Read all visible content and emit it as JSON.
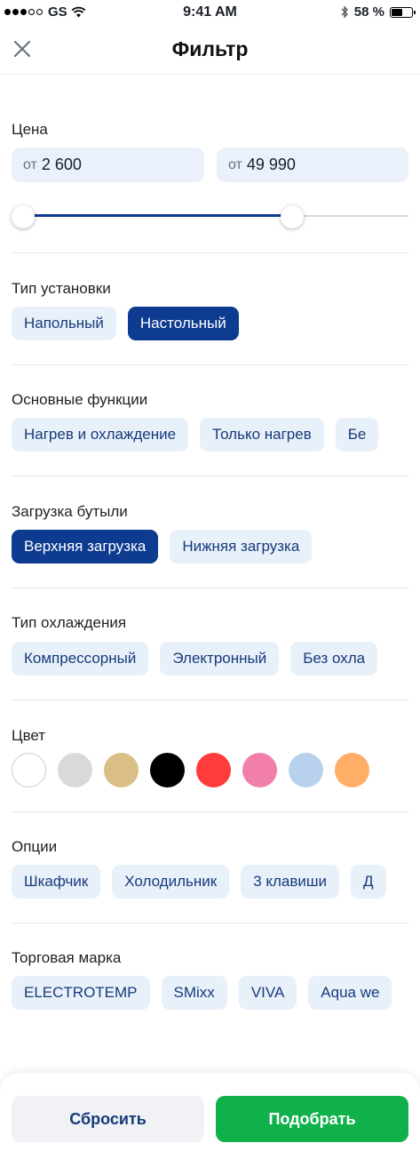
{
  "status_bar": {
    "carrier": "GS",
    "time": "9:41 AM",
    "battery": "58 %",
    "battery_level": 0.58
  },
  "header": {
    "title": "Фильтр",
    "close_icon": "close-icon"
  },
  "price": {
    "title": "Цена",
    "from_prefix": "от",
    "from_value": "2 600",
    "to_prefix": "от",
    "to_value": "49 990",
    "slider_min_fraction": 0.0,
    "slider_max_fraction": 0.72
  },
  "install_type": {
    "title": "Тип установки",
    "options": [
      {
        "label": "Напольный",
        "active": false
      },
      {
        "label": "Настольный",
        "active": true
      }
    ]
  },
  "functions": {
    "title": "Основные функции",
    "options": [
      {
        "label": "Нагрев и охлаждение",
        "active": false
      },
      {
        "label": "Только нагрев",
        "active": false
      },
      {
        "label": "Бе",
        "active": false
      }
    ]
  },
  "bottle_load": {
    "title": "Загрузка бутыли",
    "options": [
      {
        "label": "Верхняя загрузка",
        "active": true
      },
      {
        "label": "Нижняя загрузка",
        "active": false
      }
    ]
  },
  "cooling_type": {
    "title": "Тип охлаждения",
    "options": [
      {
        "label": "Компрессорный",
        "active": false
      },
      {
        "label": "Электронный",
        "active": false
      },
      {
        "label": "Без охла",
        "active": false
      }
    ]
  },
  "colors": {
    "title": "Цвет",
    "swatches": [
      "#ffffff",
      "#d9d9d9",
      "#d9bf85",
      "#000000",
      "#ff3b3b",
      "#f27fa9",
      "#b8d2ee",
      "#ffae67"
    ]
  },
  "options": {
    "title": "Опции",
    "options": [
      {
        "label": "Шкафчик",
        "active": false
      },
      {
        "label": "Холодильник",
        "active": false
      },
      {
        "label": "3 клавиши",
        "active": false
      },
      {
        "label": "Д",
        "active": false
      }
    ]
  },
  "brand": {
    "title": "Торговая марка",
    "options": [
      {
        "label": "ELECTROTEMP",
        "active": false
      },
      {
        "label": "SMixx",
        "active": false
      },
      {
        "label": "VIVA",
        "active": false
      },
      {
        "label": "Aqua we",
        "active": false
      }
    ]
  },
  "footer": {
    "reset_label": "Сбросить",
    "apply_label": "Подобрать",
    "reset_color": "#f0f2f5",
    "apply_color": "#10b14b"
  },
  "accent_color": "#0c3b8f"
}
